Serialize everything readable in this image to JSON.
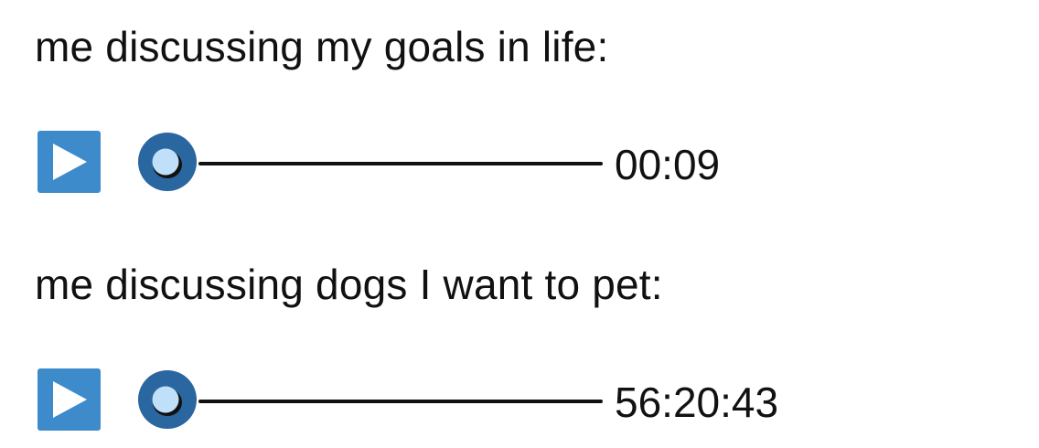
{
  "theme": {
    "button_color": "#3d8bca",
    "knob_outer_color": "#2a66a0",
    "knob_inner_color": "#bfe0f8",
    "track_color": "#111111",
    "text_color": "#111111"
  },
  "posts": [
    {
      "caption": "me discussing my goals in life:",
      "player": {
        "play_icon": "play-icon",
        "progress": 0,
        "duration": "00:09"
      }
    },
    {
      "caption": "me discussing dogs I want to pet:",
      "player": {
        "play_icon": "play-icon",
        "progress": 0,
        "duration": "56:20:43"
      }
    }
  ]
}
